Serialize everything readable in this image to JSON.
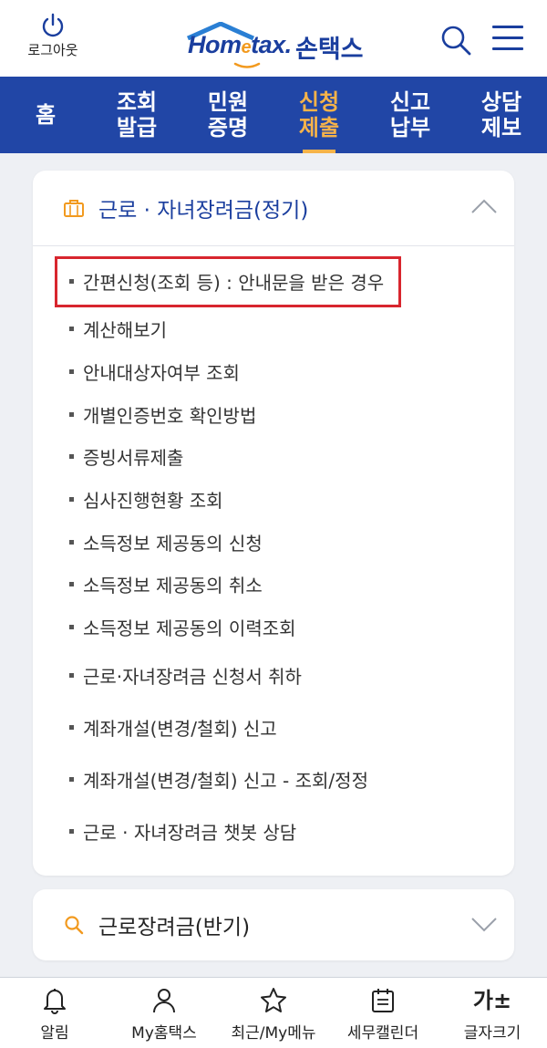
{
  "header": {
    "logout_label": "로그아웃",
    "logo_brand": "Hometax.",
    "logo_sub": "손택스",
    "search_icon": "search-icon",
    "menu_icon": "hamburger-menu-icon"
  },
  "nav": {
    "items": [
      {
        "label": "홈",
        "active": false
      },
      {
        "label": "조회\n발급",
        "active": false
      },
      {
        "label": "민원\n증명",
        "active": false
      },
      {
        "label": "신청\n제출",
        "active": true
      },
      {
        "label": "신고\n납부",
        "active": false
      },
      {
        "label": "상담\n제보",
        "active": false
      }
    ]
  },
  "section1": {
    "title": "근로 · 자녀장려금(정기)",
    "icon": "briefcase-icon",
    "expanded": true,
    "items": [
      "간편신청(조회 등) : 안내문을 받은 경우",
      "계산해보기",
      "안내대상자여부 조회",
      "개별인증번호 확인방법",
      "증빙서류제출",
      "심사진행현황 조회",
      "소득정보 제공동의 신청",
      "소득정보 제공동의 취소",
      "소득정보 제공동의 이력조회",
      "근로·자녀장려금 신청서 취하",
      "계좌개설(변경/철회) 신고",
      "계좌개설(변경/철회) 신고 - 조회/정정",
      "근로 · 자녀장려금 챗봇 상담"
    ]
  },
  "section2": {
    "title": "근로장려금(반기)",
    "icon": "search-icon",
    "expanded": false
  },
  "tabbar": {
    "items": [
      {
        "label": "알림",
        "icon": "bell-icon"
      },
      {
        "label": "My홈택스",
        "icon": "person-icon"
      },
      {
        "label": "최근/My메뉴",
        "icon": "star-icon"
      },
      {
        "label": "세무캘린더",
        "icon": "calendar-icon"
      },
      {
        "label": "글자크기",
        "icon": "font-size-icon",
        "glyph": "가±"
      }
    ]
  },
  "colors": {
    "brand_blue": "#2146a6",
    "active_orange": "#f6b34a",
    "highlight_red": "#d8262e"
  }
}
